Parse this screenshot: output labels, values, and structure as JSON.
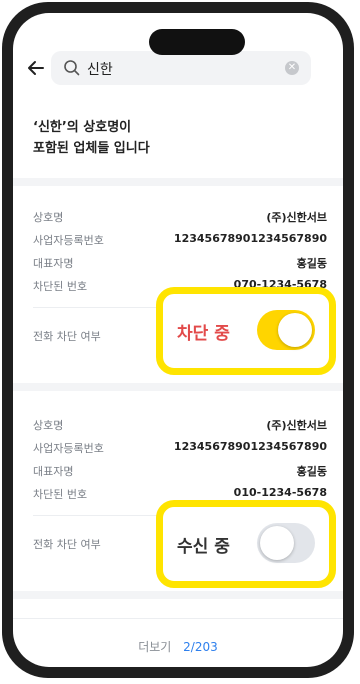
{
  "search": {
    "query": "신한"
  },
  "headline": {
    "line1": "‘신한’의 상호명이",
    "line2": "포함된 업체들 입니다"
  },
  "labels": {
    "company": "상호명",
    "biz_no": "사업자등록번호",
    "ceo": "대표자명",
    "blocked_no": "차단된 번호",
    "block_toggle": "전화 차단 여부"
  },
  "results": [
    {
      "company": "(주)신한서브",
      "biz_no": "12345678901234567890",
      "ceo": "홍길동",
      "blocked_no": "070-1234-5678"
    },
    {
      "company": "(주)신한서브",
      "biz_no": "12345678901234567890",
      "ceo": "홍길동",
      "blocked_no": "010-1234-5678"
    }
  ],
  "callouts": [
    {
      "label": "차단 중",
      "state": "on"
    },
    {
      "label": "수신 중",
      "state": "off"
    }
  ],
  "footer": {
    "more_label": "더보기",
    "page_label": "2/203"
  },
  "colors": {
    "accent_yellow": "#ffe400",
    "toggle_on": "#ffd500",
    "blocked_text": "#e24a4a",
    "page_blue": "#2f80ed"
  }
}
